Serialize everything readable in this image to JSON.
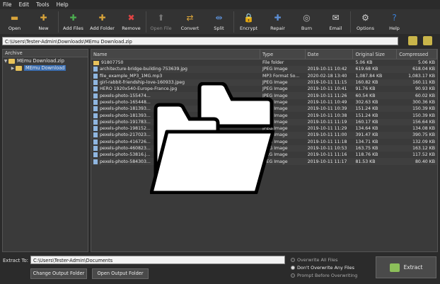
{
  "menu": [
    "File",
    "Edit",
    "Tools",
    "Help"
  ],
  "toolbar": [
    {
      "label": "Open",
      "icon": "folder-open-icon",
      "color": "#d9a43a",
      "glyph": "▬",
      "enabled": true
    },
    {
      "label": "New",
      "icon": "new-archive-icon",
      "color": "#d9a43a",
      "glyph": "✚",
      "enabled": true
    },
    {
      "label": "Add Files",
      "icon": "add-files-icon",
      "color": "#4caf50",
      "glyph": "✚",
      "enabled": true
    },
    {
      "label": "Add Folder",
      "icon": "add-folder-icon",
      "color": "#d9a43a",
      "glyph": "✚",
      "enabled": true
    },
    {
      "label": "Remove",
      "icon": "remove-icon",
      "color": "#e04444",
      "glyph": "✖",
      "enabled": true
    },
    {
      "label": "Open File",
      "icon": "open-file-icon",
      "color": "#777",
      "glyph": "⬆",
      "enabled": false
    },
    {
      "label": "Convert",
      "icon": "convert-icon",
      "color": "#d9a43a",
      "glyph": "⇄",
      "enabled": true
    },
    {
      "label": "Split",
      "icon": "split-icon",
      "color": "#5c8fd6",
      "glyph": "⇹",
      "enabled": true
    },
    {
      "label": "Encrypt",
      "icon": "lock-icon",
      "color": "#c7c7c7",
      "glyph": "🔒",
      "enabled": true
    },
    {
      "label": "Repair",
      "icon": "repair-icon",
      "color": "#5c8fd6",
      "glyph": "✚",
      "enabled": true
    },
    {
      "label": "Burn",
      "icon": "disc-icon",
      "color": "#bbbbbb",
      "glyph": "◎",
      "enabled": true
    },
    {
      "label": "Email",
      "icon": "email-icon",
      "color": "#dcdcdc",
      "glyph": "✉",
      "enabled": true
    },
    {
      "label": "Options",
      "icon": "options-icon",
      "color": "#cfcfcf",
      "glyph": "⚙",
      "enabled": true
    },
    {
      "label": "Help",
      "icon": "help-icon",
      "color": "#3b7fd4",
      "glyph": "?",
      "enabled": true
    }
  ],
  "path": "C:\\Users\\Tester-Admin\\Downloads\\MEmu Download.zip",
  "tree": {
    "header": "Archive",
    "root": "MEmu Download.zip",
    "child": "MEmu Download"
  },
  "columns": {
    "name": "Name",
    "type": "Type",
    "date": "Date",
    "orig": "Original Size",
    "comp": "Compressed"
  },
  "files": [
    {
      "name": "91807750",
      "type": "File folder",
      "date": "",
      "orig": "5.06 KB",
      "comp": "5.06 KB",
      "folder": true
    },
    {
      "name": "architecture-bridge-building-753639.jpg",
      "type": "JPEG Image",
      "date": "2019-10-11 10:42",
      "orig": "619.68 KB",
      "comp": "618.04 KB"
    },
    {
      "name": "file_example_MP3_1MG.mp3",
      "type": "MP3 Format So...",
      "date": "2020-02-18 13:40",
      "orig": "1,087.84 KB",
      "comp": "1,083.17 KB"
    },
    {
      "name": "girl-rabbit-friendship-love-160933.jpeg",
      "type": "JPEG Image",
      "date": "2019-10-11 11:15",
      "orig": "160.82 KB",
      "comp": "160.11 KB"
    },
    {
      "name": "HERO 1920x540-Europe-France.jpg",
      "type": "JPEG Image",
      "date": "2019-10-11 10:41",
      "orig": "91.76 KB",
      "comp": "90.93 KB"
    },
    {
      "name": "pexels-photo-155474...",
      "type": "JPEG Image",
      "date": "2019-10-11 11:26",
      "orig": "60.54 KB",
      "comp": "60.02 KB"
    },
    {
      "name": "pexels-photo-165448...",
      "type": "JPEG Image",
      "date": "2019-10-11 10:49",
      "orig": "302.63 KB",
      "comp": "300.36 KB"
    },
    {
      "name": "pexels-photo-181393...",
      "type": "JPEG Image",
      "date": "2019-10-11 10:39",
      "orig": "151.24 KB",
      "comp": "150.39 KB"
    },
    {
      "name": "pexels-photo-181393...",
      "type": "JPEG Image",
      "date": "2019-10-11 10:38",
      "orig": "151.24 KB",
      "comp": "150.39 KB"
    },
    {
      "name": "pexels-photo-191783...",
      "type": "JPEG Image",
      "date": "2019-10-11 11:19",
      "orig": "160.17 KB",
      "comp": "156.64 KB"
    },
    {
      "name": "pexels-photo-198152...",
      "type": "JPEG Image",
      "date": "2019-10-11 11:29",
      "orig": "134.64 KB",
      "comp": "134.08 KB"
    },
    {
      "name": "pexels-photo-217023...",
      "type": "JPEG Image",
      "date": "2019-10-11 11:00",
      "orig": "391.47 KB",
      "comp": "390.75 KB"
    },
    {
      "name": "pexels-photo-416726...",
      "type": "JPEG Image",
      "date": "2019-10-11 11:18",
      "orig": "134.71 KB",
      "comp": "132.09 KB"
    },
    {
      "name": "pexels-photo-460823...",
      "type": "JPEG Image",
      "date": "2019-10-11 10:53",
      "orig": "163.75 KB",
      "comp": "163.12 KB"
    },
    {
      "name": "pexels-photo-53816.j...",
      "type": "JPEG Image",
      "date": "2019-10-11 11:16",
      "orig": "118.76 KB",
      "comp": "117.52 KB"
    },
    {
      "name": "pexels-photo-584303...",
      "type": "JPEG Image",
      "date": "2019-10-11 11:17",
      "orig": "81.53 KB",
      "comp": "80.40 KB"
    }
  ],
  "bottom": {
    "extract_to_label": "Extract To:",
    "extract_path": "C:\\Users\\Tester-Admin\\Documents",
    "change_btn": "Change Output Folder",
    "open_btn": "Open Output Folder",
    "radio": [
      "Overwrite All Files",
      "Don't Overwrite Any Files",
      "Prompt Before Overwriting"
    ],
    "radio_selected": 1,
    "extract_btn": "Extract"
  }
}
